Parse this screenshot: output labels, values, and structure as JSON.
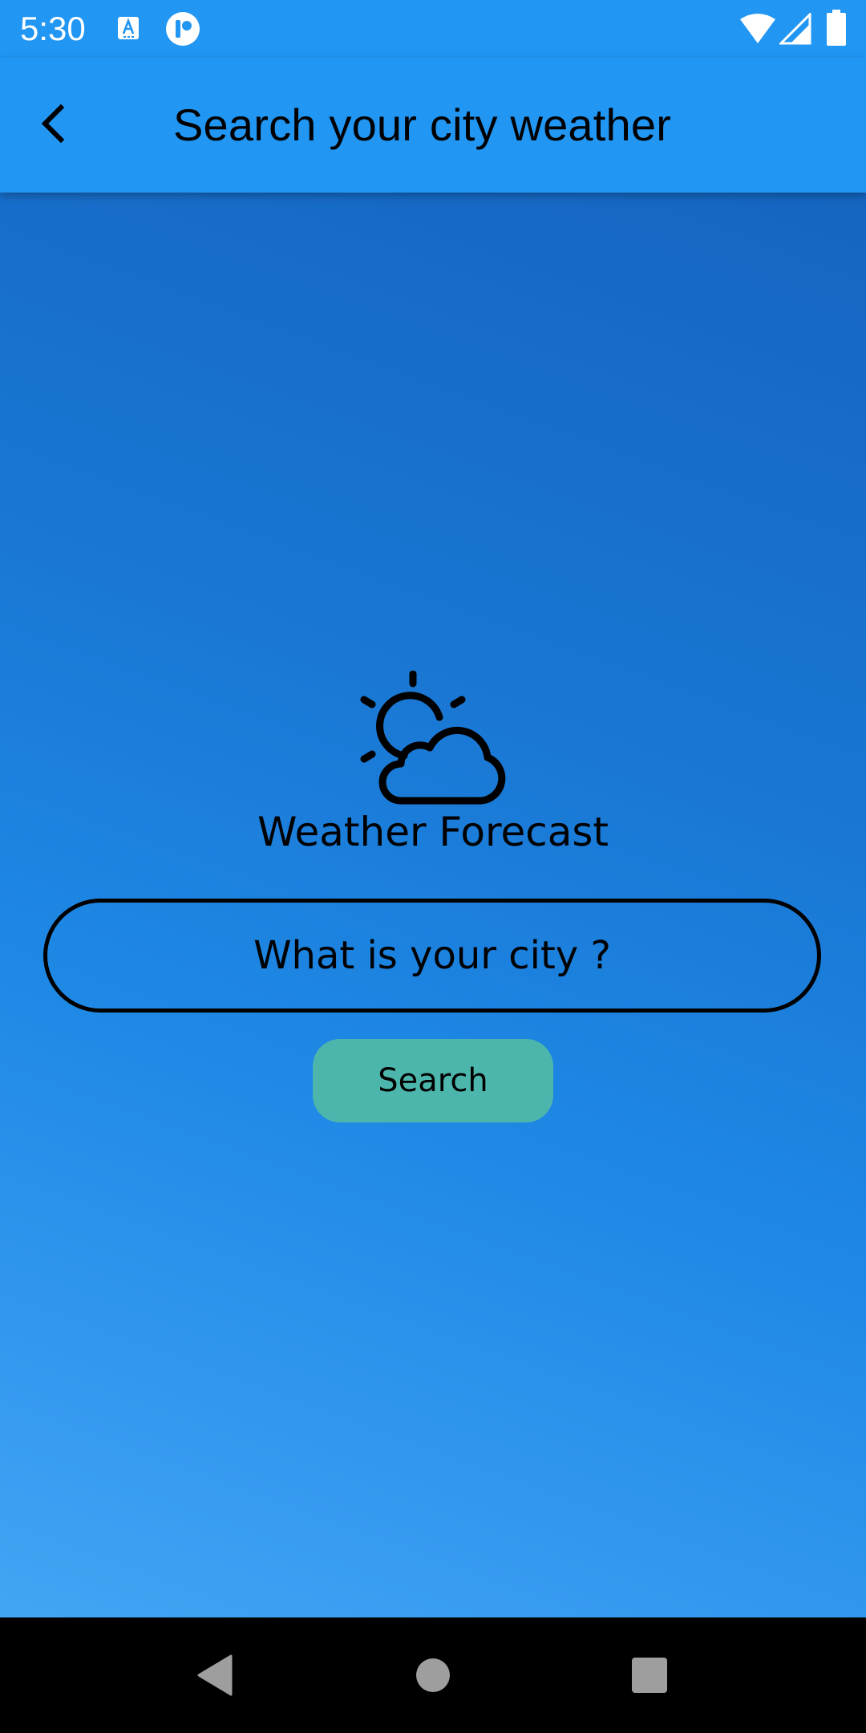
{
  "status_bar": {
    "time": "5:30",
    "icons": [
      "text-a-icon",
      "circle-r-icon",
      "wifi-icon",
      "cell-signal-icon",
      "battery-icon"
    ]
  },
  "app_bar": {
    "title": "Search your city weather",
    "back_icon": "chevron-left-icon"
  },
  "main": {
    "brand_icon": "sun-behind-cloud-icon",
    "brand_title": "Weather Forecast",
    "city_input": {
      "placeholder": "What is your city ?",
      "value": ""
    },
    "search_label": "Search"
  },
  "nav_bar": {
    "icons": [
      "nav-back-icon",
      "nav-home-icon",
      "nav-recents-icon"
    ]
  },
  "colors": {
    "app_bar": "#2196F3",
    "gradient_top": "#1565C0",
    "gradient_bottom": "#42A5F5",
    "search_button": "#4DB6AC",
    "nav_bar": "#000000"
  }
}
